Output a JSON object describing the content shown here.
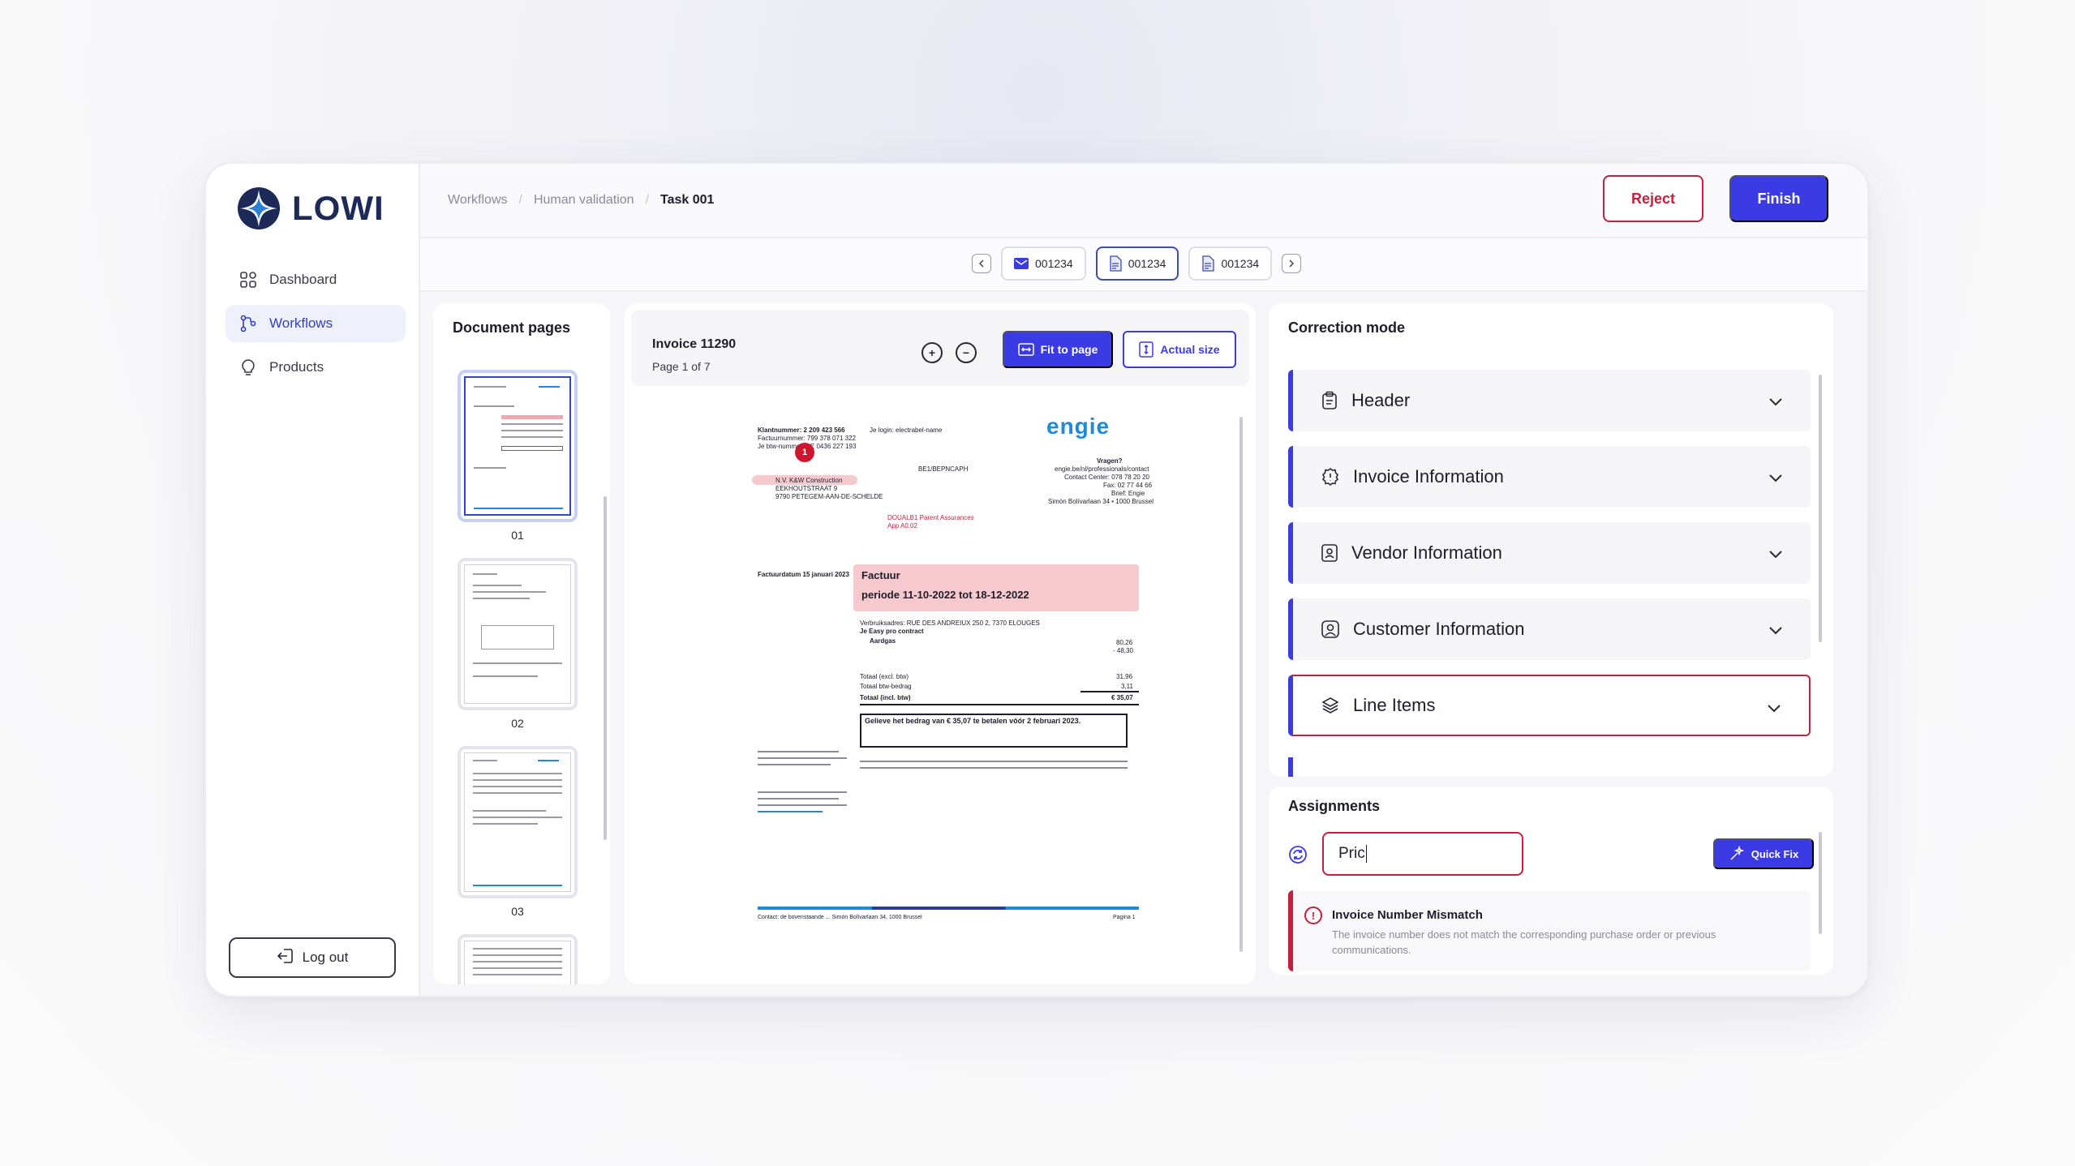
{
  "app": {
    "brand": "LOWI",
    "colors": {
      "accent": "#3b3be6",
      "danger": "#c81e3c",
      "brand_navy": "#1d2a57"
    }
  },
  "sidebar": {
    "items": [
      {
        "label": "Dashboard",
        "icon": "grid-icon"
      },
      {
        "label": "Workflows",
        "icon": "workflow-icon",
        "active": true
      },
      {
        "label": "Products",
        "icon": "lightbulb-icon"
      }
    ],
    "logout_label": "Log out"
  },
  "header": {
    "breadcrumb": [
      "Workflows",
      "Human validation",
      "Task 001"
    ],
    "reject_label": "Reject",
    "finish_label": "Finish"
  },
  "doc_tabs": [
    {
      "label": "001234",
      "icon": "mail-icon"
    },
    {
      "label": "001234",
      "icon": "document-icon",
      "active": true
    },
    {
      "label": "001234",
      "icon": "document-icon"
    }
  ],
  "pages_panel": {
    "title": "Document pages",
    "pages": [
      "01",
      "02",
      "03"
    ]
  },
  "viewer": {
    "title": "Invoice 11290",
    "page_info": "Page 1 of 7",
    "fit_label": "Fit to page",
    "actual_label": "Actual size",
    "document": {
      "logo": "engie",
      "marker": "1",
      "client_lines": [
        "Klantnummer: 2 209 423 566",
        "Factuurnummer: 799 378 071 322",
        "Je btw-nummer: BE 0436 227 193"
      ],
      "login_line": "Je login: electrabel-name",
      "recipient": [
        "N.V. K&W Construction",
        "EEKHOUTSTRAAT 9",
        "9790 PETEGEM-AAN-DE-SCHELDE"
      ],
      "ref_code": "BE1/BEPNCAPH",
      "red_note": [
        "DOUALB1 Parent Assurances",
        "App A0.02"
      ],
      "contact_title": "Vragen?",
      "contact_lines": [
        "engie.be/nl/professionals/contact",
        "Contact Center: 078 78 20 20",
        "Fax: 02 77 44 66",
        "Brief: Engie",
        "Simón Bolívarlaan 34 • 1000 Brussel"
      ],
      "invoice_date": "Factuurdatum 15 januari 2023",
      "header_word": "Factuur",
      "period": "periode 11-10-2022 tot 18-12-2022",
      "address_line": "Verbruiksadres: RUE DES ANDREIUX 250 2, 7370 ELOUGES",
      "contract_line": "Je Easy pro contract",
      "gas_line": "Aardgas",
      "amount_1": "80,26",
      "amount_2": "- 48,30",
      "total_excl": "Totaal (excl. btw)",
      "total_excl_v": "31,96",
      "vat": "Totaal btw-bedrag",
      "vat_v": "3,11",
      "total_incl": "Totaal (incl. btw)",
      "total_incl_v": "€ 35,07",
      "notice": "Gelieve het bedrag van € 35,07 te betalen vóór 2 februari 2023.",
      "footer": "Contact: de bovenstaande ... Simón Bolívarlaan 34, 1000 Brussel",
      "page_label": "Pagina 1"
    }
  },
  "correction": {
    "title": "Correction mode",
    "sections": [
      {
        "label": "Header",
        "icon": "clipboard-icon"
      },
      {
        "label": "Invoice Information",
        "icon": "info-icon"
      },
      {
        "label": "Vendor Information",
        "icon": "vendor-icon"
      },
      {
        "label": "Customer Information",
        "icon": "user-icon"
      },
      {
        "label": "Line Items",
        "icon": "layers-icon",
        "alert": true
      }
    ]
  },
  "assignments": {
    "title": "Assignments",
    "input_value": "Pric",
    "quickfix_label": "Quick Fix",
    "issue": {
      "title": "Invoice Number Mismatch",
      "description": "The invoice number does not match the corresponding purchase order or previous communications."
    }
  }
}
